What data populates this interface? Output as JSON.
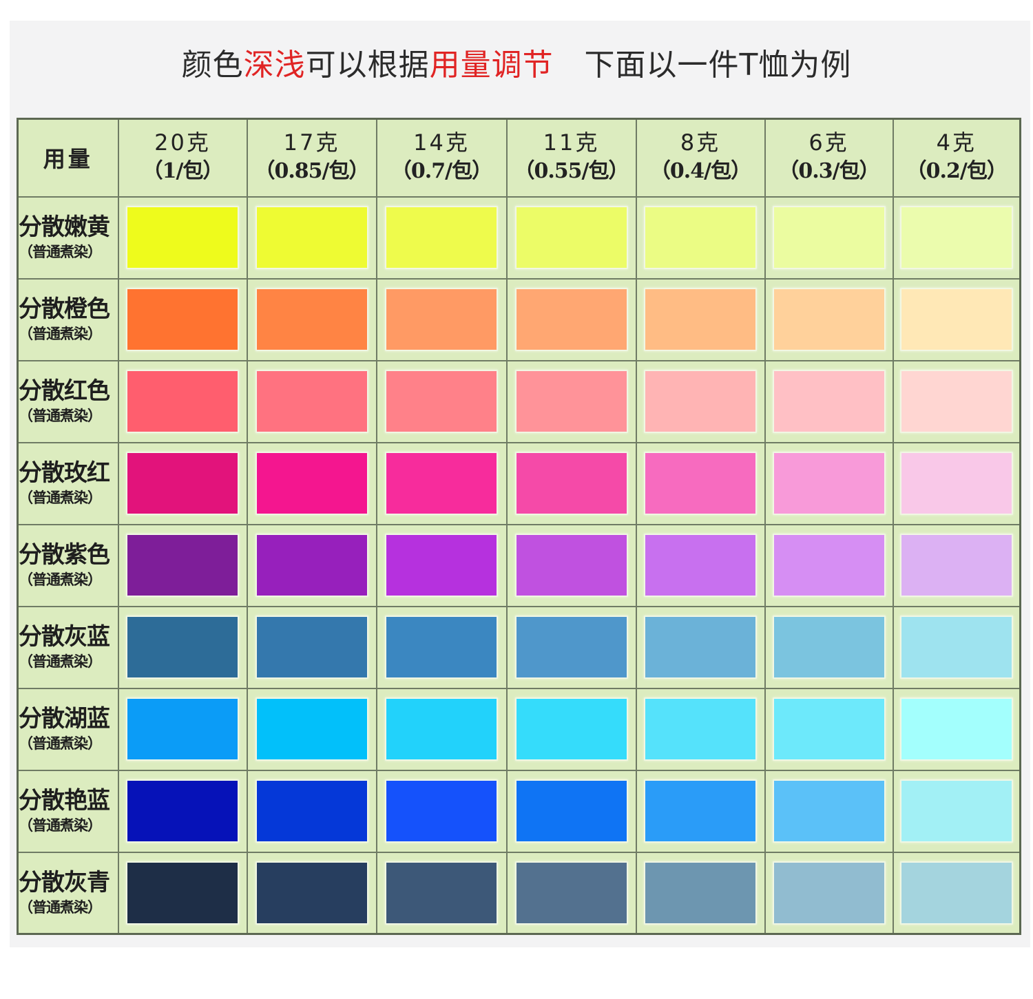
{
  "heading": {
    "part1": "颜色",
    "part2": "深浅",
    "part3": "可以根据",
    "part4": "用量调节",
    "part5": "   下面以一件T恤为例"
  },
  "table": {
    "corner_label": "用量",
    "columns": [
      {
        "grams": "20克",
        "packs": "（1/包）"
      },
      {
        "grams": "17克",
        "packs": "（0.85/包）"
      },
      {
        "grams": "14克",
        "packs": "（0.7/包）"
      },
      {
        "grams": "11克",
        "packs": "（0.55/包）"
      },
      {
        "grams": "8克",
        "packs": "（0.4/包）"
      },
      {
        "grams": "6克",
        "packs": "（0.3/包）"
      },
      {
        "grams": "4克",
        "packs": "（0.2/包）"
      }
    ],
    "rows": [
      {
        "name": "分散嫩黄",
        "sub": "（普通煮染）",
        "colors": [
          "#eefb1c",
          "#eefb33",
          "#eefb4c",
          "#ecfc67",
          "#ebfc84",
          "#ebfca0",
          "#ebfcad"
        ]
      },
      {
        "name": "分散橙色",
        "sub": "（普通煮染）",
        "colors": [
          "#ff7330",
          "#ff8444",
          "#ff9a64",
          "#ffa772",
          "#ffbc84",
          "#ffd19b",
          "#ffe8b6"
        ]
      },
      {
        "name": "分散红色",
        "sub": "（普通煮染）",
        "colors": [
          "#ff5e6e",
          "#ff7280",
          "#ff8189",
          "#ff9399",
          "#ffb4b4",
          "#ffc0c5",
          "#ffd6d2"
        ]
      },
      {
        "name": "分散玫红",
        "sub": "（普通煮染）",
        "colors": [
          "#e2137b",
          "#f4168f",
          "#f72c9c",
          "#f54aa8",
          "#f76bbf",
          "#f89ad9",
          "#f9c8e8"
        ]
      },
      {
        "name": "分散紫色",
        "sub": "（普通煮染）",
        "colors": [
          "#7e1e99",
          "#9720bc",
          "#b631de",
          "#c051e0",
          "#c870ef",
          "#d68ef3",
          "#dcb1f3"
        ]
      },
      {
        "name": "分散灰蓝",
        "sub": "（普通煮染）",
        "colors": [
          "#2d6c98",
          "#3478ad",
          "#3b87c1",
          "#4f97cb",
          "#6bb2d8",
          "#7bc4df",
          "#9ee3ef"
        ]
      },
      {
        "name": "分散湖蓝",
        "sub": "（普通煮染）",
        "colors": [
          "#0b9cf7",
          "#02c0fa",
          "#22d2fb",
          "#35dcfb",
          "#55e2fb",
          "#6de9fb",
          "#a3fffd"
        ]
      },
      {
        "name": "分散艳蓝",
        "sub": "（普通煮染）",
        "colors": [
          "#0612b8",
          "#0538d8",
          "#1552fb",
          "#0f74f4",
          "#2a9cf8",
          "#5bc1f8",
          "#a2f0f5"
        ]
      },
      {
        "name": "分散灰青",
        "sub": "（普通煮染）",
        "colors": [
          "#1e2e47",
          "#273e5f",
          "#3d5878",
          "#53718f",
          "#6d96b0",
          "#91bcd0",
          "#a4d4de"
        ]
      }
    ]
  }
}
